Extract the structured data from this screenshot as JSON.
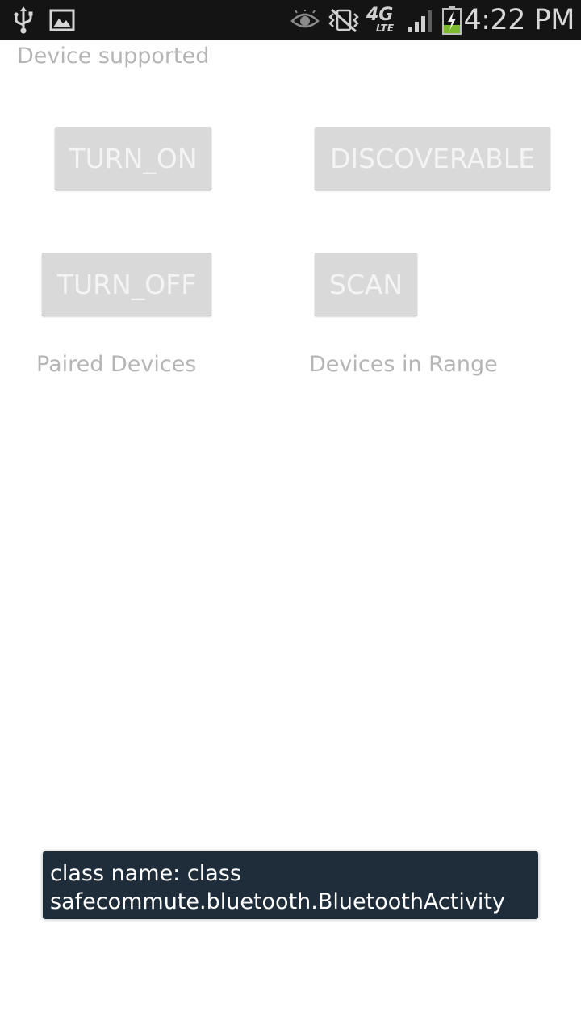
{
  "status_bar": {
    "time": "4:22 PM",
    "network_label": "4G",
    "network_sublabel": "LTE",
    "icons": [
      "usb-icon",
      "image-icon",
      "eye-icon",
      "no-vibrate-icon",
      "lte-icon",
      "signal-icon",
      "battery-charging-icon"
    ],
    "battery_color": "#7dbb2e"
  },
  "main": {
    "device_status": "Device supported",
    "buttons": {
      "turn_on": "TURN_ON",
      "discoverable": "DISCOVERABLE",
      "turn_off": "TURN_OFF",
      "scan": "SCAN"
    },
    "paired_devices_label": "Paired Devices",
    "devices_in_range_label": "Devices in Range"
  },
  "toast": {
    "line1": "class name: class",
    "line2": "safecommute.bluetooth.BluetoothActivity"
  }
}
